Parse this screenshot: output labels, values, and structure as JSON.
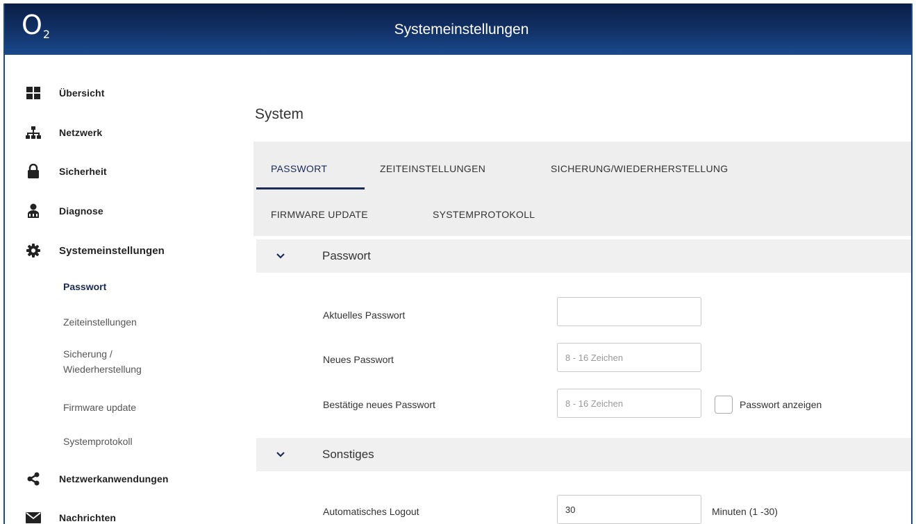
{
  "header": {
    "logo_text": "O",
    "logo_sub": "2",
    "title": "Systemeinstellungen"
  },
  "sidebar": {
    "items": [
      {
        "label": "Übersicht",
        "icon": "grid-icon"
      },
      {
        "label": "Netzwerk",
        "icon": "network-icon"
      },
      {
        "label": "Sicherheit",
        "icon": "lock-icon"
      },
      {
        "label": "Diagnose",
        "icon": "person-icon"
      },
      {
        "label": "Systemeinstellungen",
        "icon": "gear-icon"
      },
      {
        "label": "Netzwerkanwendungen",
        "icon": "share-icon"
      },
      {
        "label": "Nachrichten",
        "icon": "envelope-icon"
      }
    ],
    "subitems": [
      {
        "label": "Passwort",
        "active": true
      },
      {
        "label": "Zeiteinstellungen"
      },
      {
        "label": "Sicherung / Wiederherstellung",
        "line1": "Sicherung /",
        "line2": "Wiederherstellung"
      },
      {
        "label": "Firmware update"
      },
      {
        "label": "Systemprotokoll"
      }
    ]
  },
  "main": {
    "page_title": "System",
    "tabs": [
      {
        "label": "PASSWORT",
        "active": true
      },
      {
        "label": "ZEITEINSTELLUNGEN"
      },
      {
        "label": "SICHERUNG/WIEDERHERSTELLUNG"
      },
      {
        "label": "FIRMWARE UPDATE"
      },
      {
        "label": "SYSTEMPROTOKOLL"
      }
    ],
    "sections": {
      "password": {
        "title": "Passwort",
        "current_label": "Aktuelles Passwort",
        "current_value": "",
        "new_label": "Neues Passwort",
        "new_placeholder": "8 - 16 Zeichen",
        "confirm_label": "Bestätige neues Passwort",
        "confirm_placeholder": "8 - 16 Zeichen",
        "show_password_label": "Passwort anzeigen",
        "show_password_checked": false
      },
      "other": {
        "title": "Sonstiges",
        "logout_label": "Automatisches Logout",
        "logout_value": "30",
        "logout_unit": "Minuten (1 -30)"
      }
    }
  },
  "colors": {
    "header_dark": "#0a1e45",
    "header_light": "#1a4a8e",
    "accent": "#1a2a55",
    "tab_bg": "#eeeeee"
  }
}
